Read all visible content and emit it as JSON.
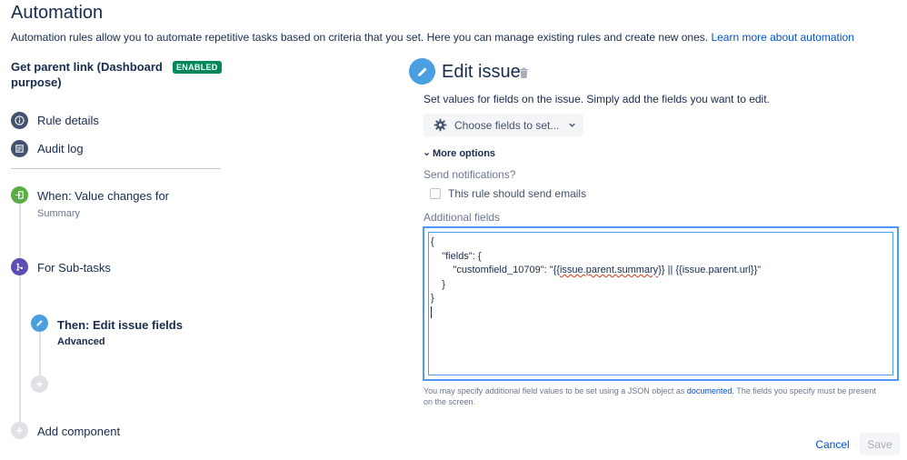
{
  "page": {
    "title": "Automation",
    "description": "Automation rules allow you to automate repetitive tasks based on criteria that you set. Here you can manage existing rules and create new ones.",
    "learn_more": "Learn more about automation"
  },
  "rule": {
    "name": "Get parent link (Dashboard purpose)",
    "status": "ENABLED"
  },
  "nav": {
    "rule_details": "Rule details",
    "audit_log": "Audit log"
  },
  "steps": {
    "trigger_label": "When: Value changes for",
    "trigger_sub": "Summary",
    "branch_label": "For Sub-tasks",
    "action_label": "Then: Edit issue fields",
    "action_sub": "Advanced",
    "add_component": "Add component"
  },
  "editor": {
    "title": "Edit issue",
    "description": "Set values for fields on the issue. Simply add the fields you want to edit.",
    "choose_fields": "Choose fields to set...",
    "more_options": "More options",
    "send_notifications": "Send notifications?",
    "send_emails_label": "This rule should send emails",
    "additional_fields_label": "Additional fields",
    "json_lines": {
      "l1": "{",
      "l2": "    \"fields\": {",
      "l3a": "        \"customfield_10709\": \"{{",
      "l3b": "issue.parent.summary",
      "l3c": "}} || {{issue.parent.url}}\"",
      "l4": "    }",
      "l5": "}"
    },
    "helper_text_1": "You may specify additional field values to be set using a JSON object as",
    "helper_link": "documented",
    "helper_text_2": ". The fields you specify must be present on the screen.",
    "cancel": "Cancel",
    "save": "Save"
  },
  "colors": {
    "enabled_badge": "#00875a",
    "trigger_green": "#5aac44",
    "branch_purple": "#5e4db2",
    "action_blue": "#4a9fe0",
    "link_blue": "#0052cc",
    "focus_blue": "#4c9aff"
  }
}
